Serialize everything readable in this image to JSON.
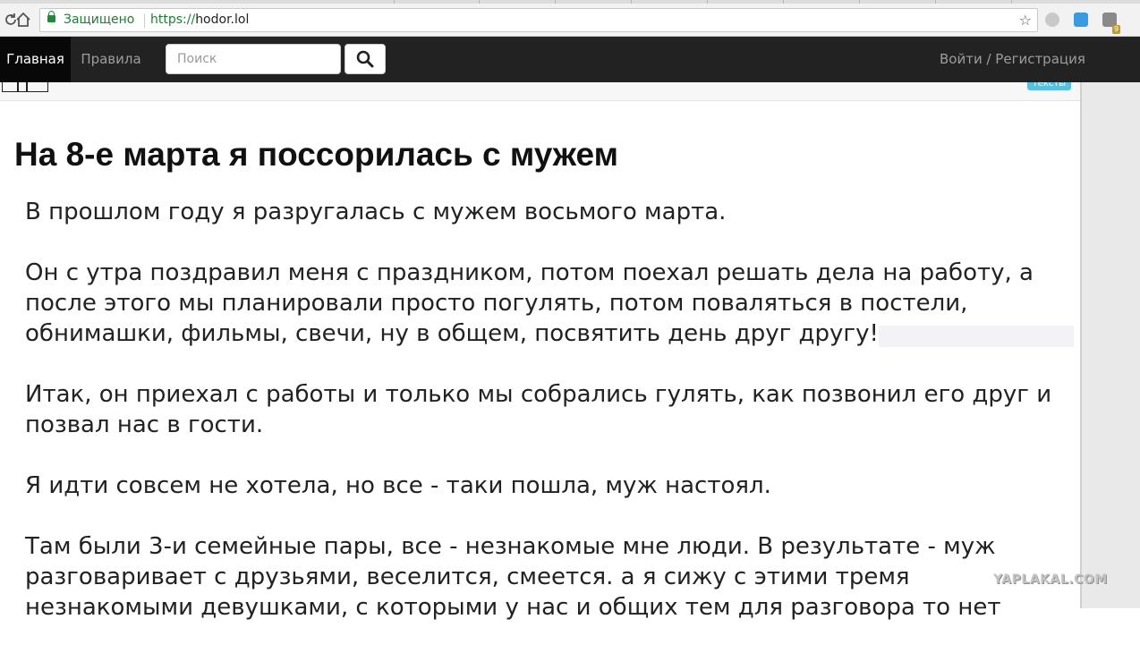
{
  "browser": {
    "secure_label": "Защищено",
    "url_scheme": "https://",
    "url_host": "hodor.lol",
    "extension_badge": "9"
  },
  "navbar": {
    "home": "Главная",
    "rules": "Правила",
    "search_placeholder": "Поиск",
    "login": "Войти / Регистрация"
  },
  "tag": "тексты",
  "article": {
    "title": "На 8-е марта я поссорилась с мужем",
    "paragraphs": [
      "В прошлом году я разругалась с мужем восьмого марта.",
      "Он с утра поздравил меня с праздником, потом поехал решать дела на работу, а после этого мы планировали просто погулять, потом поваляться в постели, обнимашки, фильмы, свечи, ну в общем, посвятить день друг другу!",
      "Итак, он приехал с работы и только мы собрались гулять, как позвонил его друг и позвал нас в гости.",
      "Я идти совсем не хотела, но все - таки пошла, муж настоял.",
      "Там были 3-и семейные пары, все - незнакомые мне люди. В результате - муж разговаривает с друзьями, веселится, смеется. а я сижу с этими тремя незнакомыми девушками, с которыми у нас и общих тем для разговора то нет"
    ]
  },
  "watermark": "YAPLAKAL.COM"
}
